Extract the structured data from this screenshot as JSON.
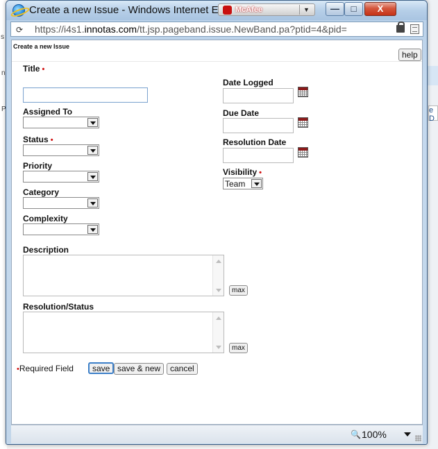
{
  "background_page": {
    "left_fragments": [
      "s",
      "n",
      "P"
    ],
    "right_fragment": "e D"
  },
  "window": {
    "title": "Create a new Issue - Windows Internet Explorer",
    "mcafee_label": "McAfee",
    "controls": {
      "minimize": "—",
      "maximize": "□",
      "close": "X"
    }
  },
  "address": {
    "scheme": "https://i4s1.",
    "host": "innotas.com",
    "path": "/tt.jsp.pageband.issue.NewBand.pa?ptid=4&pid="
  },
  "dialog": {
    "title": "Create a new Issue",
    "help_label": "help"
  },
  "form": {
    "title_label": "Title",
    "assigned_to_label": "Assigned To",
    "status_label": "Status",
    "priority_label": "Priority",
    "category_label": "Category",
    "complexity_label": "Complexity",
    "description_label": "Description",
    "resolution_status_label": "Resolution/Status",
    "date_logged_label": "Date Logged",
    "due_date_label": "Due Date",
    "resolution_date_label": "Resolution Date",
    "visibility_label": "Visibility",
    "visibility_value": "Team",
    "required_marker": "•",
    "max_label": "max"
  },
  "footer": {
    "required_text": "Required Field",
    "save_label": "save",
    "save_new_label": "save & new",
    "cancel_label": "cancel"
  },
  "statusbar": {
    "zoom": "100%"
  }
}
